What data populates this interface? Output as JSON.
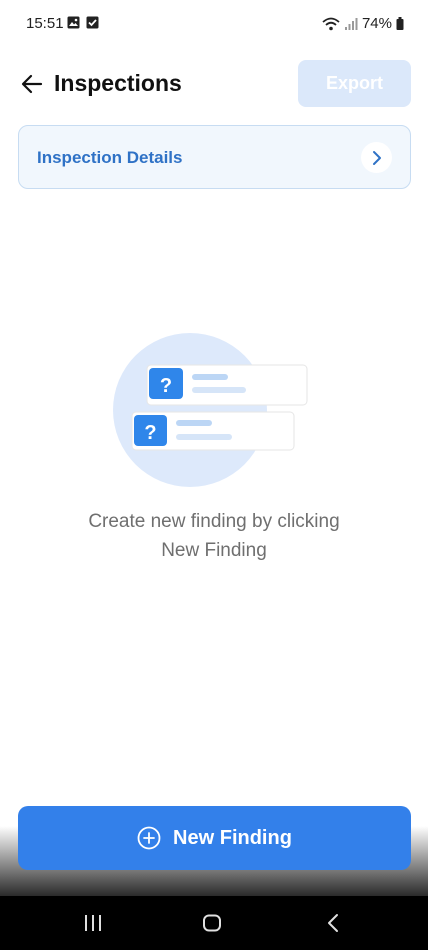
{
  "status_bar": {
    "time": "15:51",
    "battery": "74%",
    "icons": [
      "image-icon",
      "checkbox-icon",
      "wifi-icon",
      "signal-icon",
      "battery-icon"
    ]
  },
  "header": {
    "title": "Inspections",
    "back_icon": "arrow-left-icon",
    "export_label": "Export"
  },
  "details": {
    "label": "Inspection Details",
    "chevron_icon": "chevron-right-icon"
  },
  "empty_state": {
    "illustration_icon": "question-cards-illustration",
    "question_mark": "?",
    "message_line1": "Create new finding by clicking",
    "message_line2": "New Finding"
  },
  "action": {
    "new_finding_label": "New Finding",
    "icon": "plus-circle-icon"
  },
  "nav": {
    "icons": [
      "recents-icon",
      "home-icon",
      "back-icon"
    ]
  },
  "colors": {
    "primary": "#3380ea",
    "primary_disabled": "#dbe8fa",
    "details_text": "#2f72c6",
    "details_bg": "#f1f7fd",
    "muted_text": "#6f6f6f"
  }
}
